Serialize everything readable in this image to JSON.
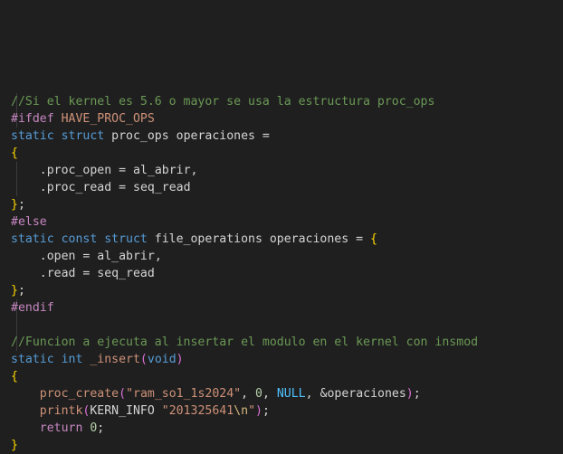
{
  "editor": {
    "background": "#1f1f1f",
    "lines": [
      [
        {
          "t": "//Si el kernel es 5.6 o mayor se usa la estructura proc_ops",
          "c": "comment"
        }
      ],
      [
        {
          "t": "#ifdef ",
          "c": "pre"
        },
        {
          "t": "HAVE_PROC_OPS",
          "c": "string"
        }
      ],
      [
        {
          "t": "static ",
          "c": "keyword"
        },
        {
          "t": "struct ",
          "c": "keyword"
        },
        {
          "t": "proc_ops ",
          "c": "plain"
        },
        {
          "t": "operaciones ",
          "c": "plain"
        },
        {
          "t": "=",
          "c": "op"
        }
      ],
      [
        {
          "t": "{",
          "c": "brace"
        }
      ],
      [
        {
          "t": "    .",
          "c": "plain"
        },
        {
          "t": "proc_open ",
          "c": "plain"
        },
        {
          "t": "= ",
          "c": "op"
        },
        {
          "t": "al_abrir",
          "c": "plain"
        },
        {
          "t": ",",
          "c": "punct"
        }
      ],
      [
        {
          "t": "    .",
          "c": "plain"
        },
        {
          "t": "proc_read ",
          "c": "plain"
        },
        {
          "t": "= ",
          "c": "op"
        },
        {
          "t": "seq_read",
          "c": "plain"
        }
      ],
      [
        {
          "t": "}",
          "c": "brace"
        },
        {
          "t": ";",
          "c": "punct"
        }
      ],
      [
        {
          "t": "#else",
          "c": "pre"
        }
      ],
      [
        {
          "t": "static ",
          "c": "keyword"
        },
        {
          "t": "const ",
          "c": "keyword"
        },
        {
          "t": "struct ",
          "c": "keyword"
        },
        {
          "t": "file_operations ",
          "c": "plain"
        },
        {
          "t": "operaciones ",
          "c": "plain"
        },
        {
          "t": "= ",
          "c": "op"
        },
        {
          "t": "{",
          "c": "brace"
        }
      ],
      [
        {
          "t": "    .",
          "c": "plain"
        },
        {
          "t": "open ",
          "c": "plain"
        },
        {
          "t": "= ",
          "c": "op"
        },
        {
          "t": "al_abrir",
          "c": "plain"
        },
        {
          "t": ",",
          "c": "punct"
        }
      ],
      [
        {
          "t": "    .",
          "c": "plain"
        },
        {
          "t": "read ",
          "c": "plain"
        },
        {
          "t": "= ",
          "c": "op"
        },
        {
          "t": "seq_read",
          "c": "plain"
        }
      ],
      [
        {
          "t": "}",
          "c": "brace"
        },
        {
          "t": ";",
          "c": "punct"
        }
      ],
      [
        {
          "t": "#endif",
          "c": "pre"
        }
      ],
      [],
      [
        {
          "t": "//Funcion a ejecuta al insertar el modulo en el kernel con insmod",
          "c": "comment"
        }
      ],
      [
        {
          "t": "static ",
          "c": "keyword"
        },
        {
          "t": "int ",
          "c": "keyword"
        },
        {
          "t": "_insert",
          "c": "string"
        },
        {
          "t": "(",
          "c": "paren"
        },
        {
          "t": "void",
          "c": "keyword"
        },
        {
          "t": ")",
          "c": "paren"
        }
      ],
      [
        {
          "t": "{",
          "c": "brace"
        }
      ],
      [
        {
          "t": "    ",
          "c": "plain"
        },
        {
          "t": "proc_create",
          "c": "string"
        },
        {
          "t": "(",
          "c": "paren"
        },
        {
          "t": "\"ram_so1_1s2024\"",
          "c": "string"
        },
        {
          "t": ", ",
          "c": "punct"
        },
        {
          "t": "0",
          "c": "number"
        },
        {
          "t": ", ",
          "c": "punct"
        },
        {
          "t": "NULL",
          "c": "const"
        },
        {
          "t": ", ",
          "c": "punct"
        },
        {
          "t": "&",
          "c": "op"
        },
        {
          "t": "operaciones",
          "c": "plain"
        },
        {
          "t": ")",
          "c": "paren"
        },
        {
          "t": ";",
          "c": "punct"
        }
      ],
      [
        {
          "t": "    ",
          "c": "plain"
        },
        {
          "t": "printk",
          "c": "string"
        },
        {
          "t": "(",
          "c": "paren"
        },
        {
          "t": "KERN_INFO ",
          "c": "plain"
        },
        {
          "t": "\"201325641",
          "c": "string"
        },
        {
          "t": "\\n",
          "c": "escape"
        },
        {
          "t": "\"",
          "c": "string"
        },
        {
          "t": ")",
          "c": "paren"
        },
        {
          "t": ";",
          "c": "punct"
        }
      ],
      [
        {
          "t": "    ",
          "c": "plain"
        },
        {
          "t": "return ",
          "c": "ctrl"
        },
        {
          "t": "0",
          "c": "number"
        },
        {
          "t": ";",
          "c": "punct"
        }
      ],
      [
        {
          "t": "}",
          "c": "brace"
        }
      ]
    ]
  }
}
